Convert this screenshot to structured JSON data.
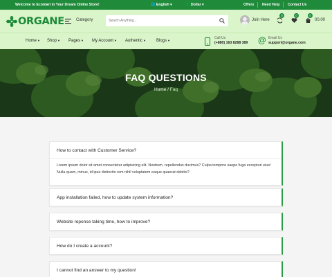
{
  "topbar": {
    "welcome": "Welcome to Ecomart in Your Dream Online Store!",
    "language": "English",
    "currency": "Dollar",
    "links": [
      "Offers",
      "Need Help",
      "Contact Us"
    ]
  },
  "header": {
    "logo_text": "ORGANE",
    "category_label": "Category",
    "search_placeholder": "Search Anything...",
    "user_label": "Join Here",
    "compare_count": "0",
    "wishlist_count": "0",
    "cart_count": "0",
    "cart_total": "00.00"
  },
  "nav": {
    "items": [
      "Home",
      "Shop",
      "Pages",
      "My Account",
      "Authentic",
      "Blogs"
    ],
    "call_label": "Call Us",
    "call_value": "(+880) 163 8288 389",
    "email_label": "Email Us",
    "email_value": "support@organe.com"
  },
  "hero": {
    "title": "FAQ QUESTIONS",
    "crumb_home": "Home",
    "crumb_sep": "/",
    "crumb_current": "Faq"
  },
  "faq": [
    {
      "question": "How to contact with Customer Service?",
      "answer": "Lorem ipsum dolor sit amet consectetur adipisicing elit. Nostrum, repellendus ducimus? Culpa tempore saepe fuga excepturi eius! Nulla quam, minus, id ipsa distinctio rem nihil voluptatem eaque quaerat debitis?"
    },
    {
      "question": "App installation failed, how to update system information?"
    },
    {
      "question": "Website reponse taking time, how to improve?"
    },
    {
      "question": "How do I create a account?"
    },
    {
      "question": "I cannot find an answer to my question!"
    }
  ],
  "colors": {
    "brand": "#1f8a3a",
    "header_bg": "#d9f5c9",
    "accent_border": "#2e9c46"
  }
}
